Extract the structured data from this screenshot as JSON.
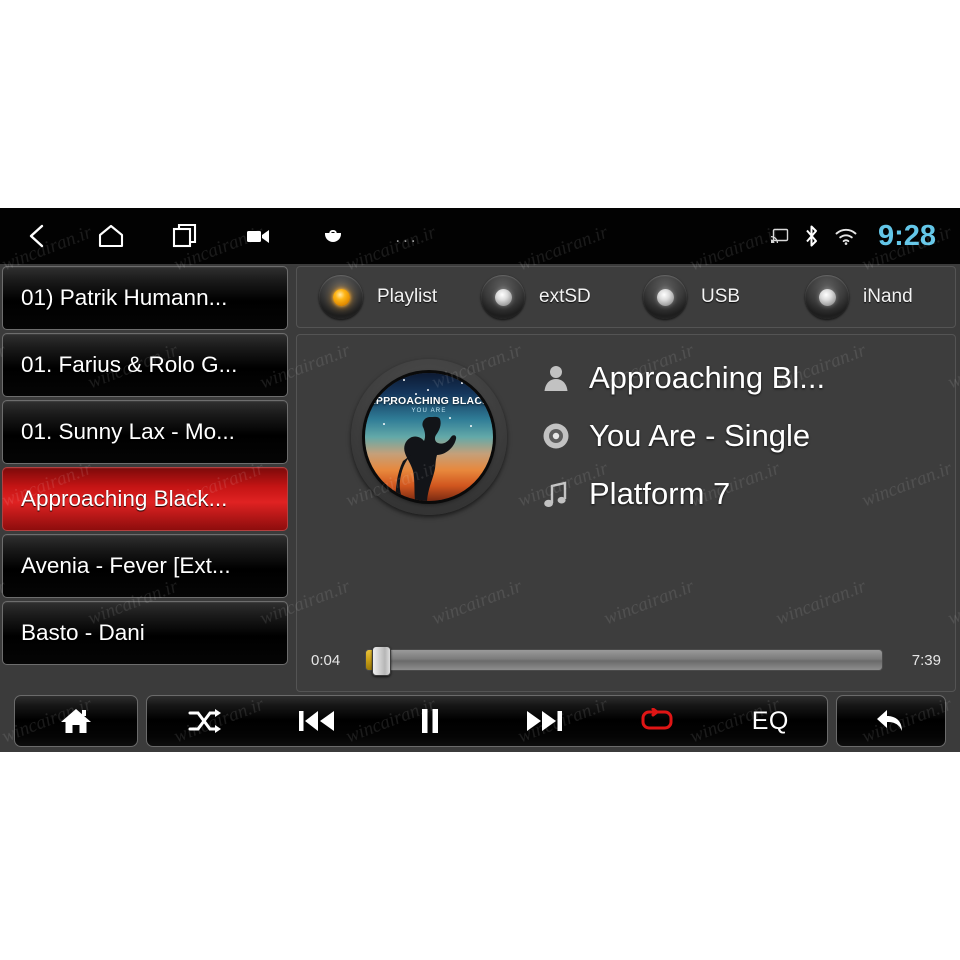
{
  "statusbar": {
    "nav": [
      {
        "name": "back-icon",
        "label": "Back"
      },
      {
        "name": "home-icon",
        "label": "Home"
      },
      {
        "name": "recents-icon",
        "label": "Recent apps"
      },
      {
        "name": "screenshot-video-icon",
        "label": "Screen record"
      },
      {
        "name": "capture-icon",
        "label": "Capture"
      },
      {
        "name": "more-options-icon",
        "label": "More"
      }
    ],
    "more_glyph": "...",
    "system_icons": [
      {
        "name": "cast-icon"
      },
      {
        "name": "bluetooth-icon"
      },
      {
        "name": "wifi-icon"
      }
    ],
    "clock": "9:28",
    "clock_color": "#63c6e8"
  },
  "playlist": {
    "tracks": [
      {
        "label": "01) Patrik Humann...",
        "active": false
      },
      {
        "label": "01. Farius & Rolo G...",
        "active": false
      },
      {
        "label": "01. Sunny Lax - Mo...",
        "active": false
      },
      {
        "label": "Approaching Black...",
        "active": true
      },
      {
        "label": "Avenia - Fever [Ext...",
        "active": false
      },
      {
        "label": "Basto - Dani",
        "active": false
      }
    ],
    "active_color": "#e02222"
  },
  "sources": [
    {
      "label": "Playlist",
      "active": true
    },
    {
      "label": "extSD",
      "active": false
    },
    {
      "label": "USB",
      "active": false
    },
    {
      "label": "iNand",
      "active": false
    }
  ],
  "source_active_color": "#ffb617",
  "artwork": {
    "headline": "APPROACHING BLACK",
    "subline": "YOU ARE"
  },
  "now_playing": {
    "rows": [
      {
        "icon": "person-icon",
        "text": "Approaching Bl..."
      },
      {
        "icon": "disc-icon",
        "text": "You Are - Single"
      },
      {
        "icon": "music-note-icon",
        "text": "Platform 7"
      }
    ]
  },
  "progress": {
    "elapsed": "0:04",
    "duration": "7:39",
    "percent": 1
  },
  "transport": {
    "home_label": "Home",
    "shuffle_label": "Shuffle",
    "previous_label": "Previous",
    "pause_label": "Pause",
    "next_label": "Next",
    "repeat_label": "Repeat",
    "repeat_active": true,
    "repeat_color": "#e01515",
    "eq_label": "EQ",
    "back_label": "Back"
  },
  "watermark": {
    "text": "wincairan.ir"
  }
}
